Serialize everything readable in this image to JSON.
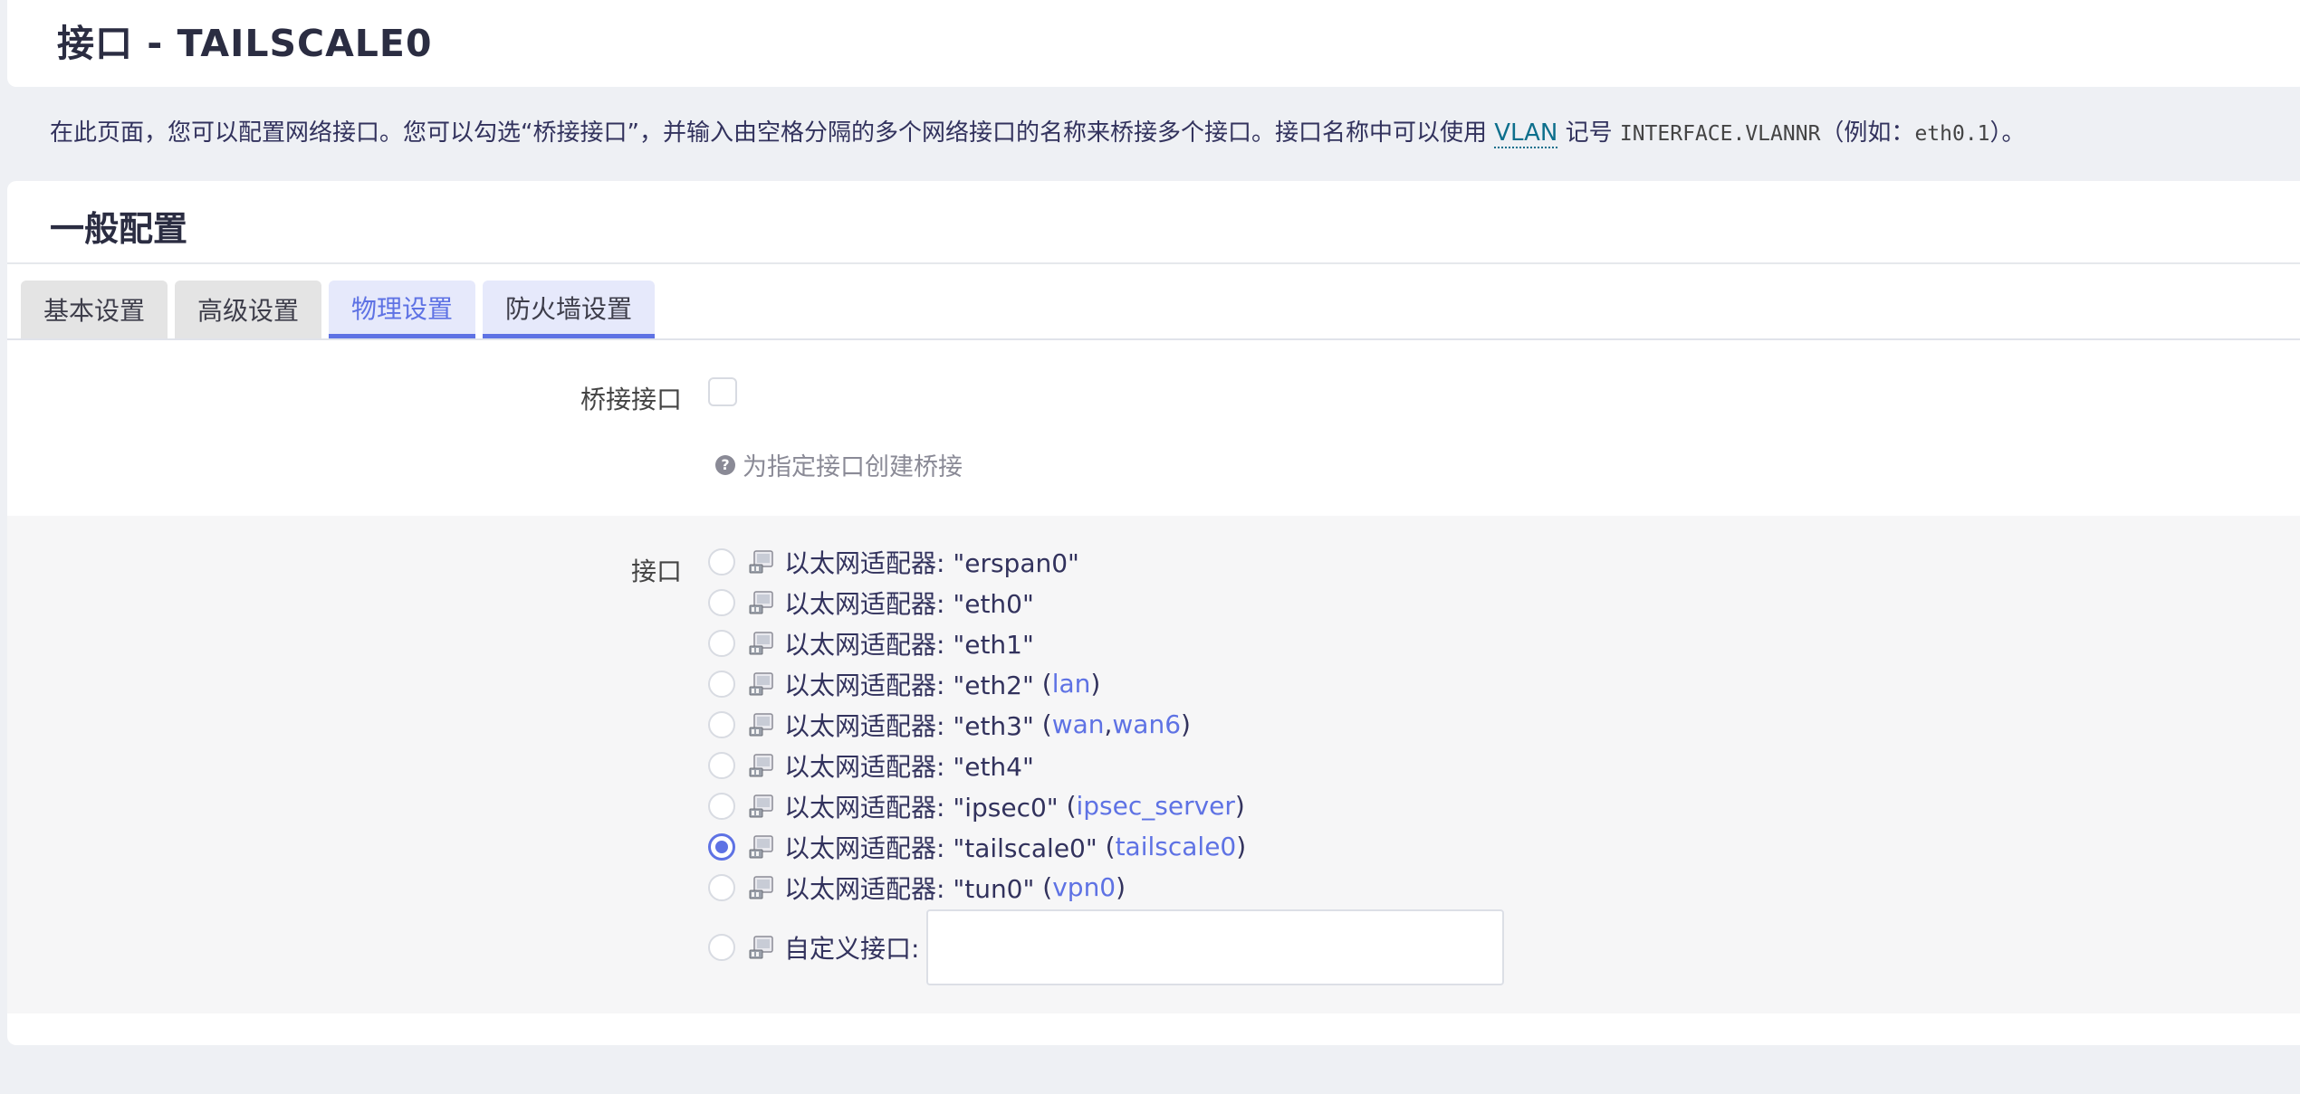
{
  "header": {
    "title": "接口 - TAILSCALE0"
  },
  "description": {
    "text_before": "在此页面，您可以配置网络接口。您可以勾选“桥接接口”，并输入由空格分隔的多个网络接口的名称来桥接多个接口。接口名称中可以使用 ",
    "vlan_link": "VLAN",
    "text_mid": " 记号 ",
    "code1": "INTERFACE.VLANNR",
    "text_mid2": "（例如：",
    "code2": "eth0.1",
    "text_after": "）。"
  },
  "section": {
    "title": "一般配置",
    "tabs": [
      {
        "label": "基本设置"
      },
      {
        "label": "高级设置"
      },
      {
        "label": "物理设置"
      },
      {
        "label": "防火墙设置"
      }
    ]
  },
  "bridge": {
    "label": "桥接接口",
    "checked": false,
    "hint": "为指定接口创建桥接"
  },
  "interface": {
    "label": "接口",
    "options": [
      {
        "prefix": "以太网适配器: \"erspan0\"",
        "nets": []
      },
      {
        "prefix": "以太网适配器: \"eth0\"",
        "nets": []
      },
      {
        "prefix": "以太网适配器: \"eth1\"",
        "nets": []
      },
      {
        "prefix": "以太网适配器: \"eth2\"",
        "nets": [
          "lan"
        ]
      },
      {
        "prefix": "以太网适配器: \"eth3\"",
        "nets": [
          "wan",
          "wan6"
        ]
      },
      {
        "prefix": "以太网适配器: \"eth4\"",
        "nets": []
      },
      {
        "prefix": "以太网适配器: \"ipsec0\"",
        "nets": [
          "ipsec_server"
        ]
      },
      {
        "prefix": "以太网适配器: \"tailscale0\"",
        "nets": [
          "tailscale0"
        ]
      },
      {
        "prefix": "以太网适配器: \"tun0\"",
        "nets": [
          "vpn0"
        ]
      }
    ],
    "selected_index": 7,
    "custom_label": "自定义接口:",
    "custom_value": ""
  },
  "colors": {
    "accent": "#5e72e4",
    "link": "#0d6f8c"
  }
}
